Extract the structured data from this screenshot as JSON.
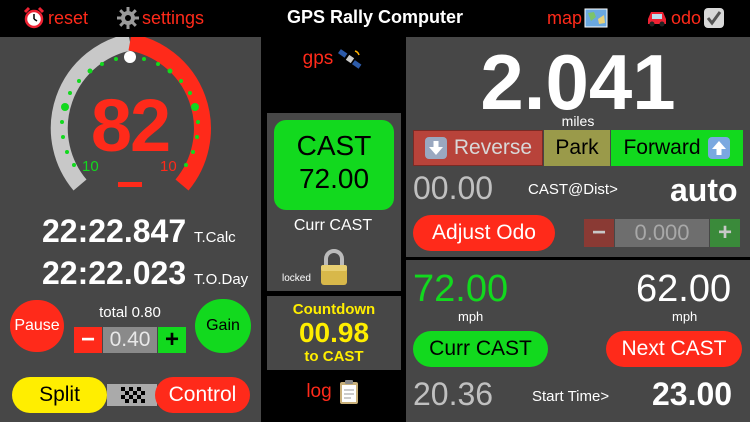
{
  "topbar": {
    "reset_label": "reset",
    "settings_label": "settings",
    "title": "GPS Rally Computer",
    "map_label": "map",
    "odo_label": "odo"
  },
  "gauge": {
    "value": "82",
    "min_label": "10",
    "max_label": "10",
    "accent": "#ff2a1a",
    "tick_color": "#12d91e"
  },
  "left": {
    "tcalc_time": "22:22.847",
    "tcalc_label": "T.Calc",
    "today_time": "22:22.023",
    "today_label": "T.O.Day",
    "pause_label": "Pause",
    "total_label": "total 0.80",
    "step_value": "0.40",
    "gain_label": "Gain",
    "split_label": "Split",
    "control_label": "Control"
  },
  "middle": {
    "gps_label": "gps",
    "cast_title": "CAST",
    "cast_value": "72.00",
    "curr_cast_label": "Curr CAST",
    "locked_label": "locked",
    "countdown_label": "Countdown",
    "countdown_value": "00.98",
    "to_cast_label": "to CAST",
    "log_label": "log"
  },
  "right_top": {
    "distance": "2.041",
    "distance_unit": "miles",
    "reverse_label": "Reverse",
    "park_label": "Park",
    "forward_label": "Forward",
    "cast_at_dist_value": "00.00",
    "cast_at_dist_label": "CAST@Dist>",
    "mode": "auto",
    "adjust_odo_label": "Adjust Odo",
    "adjust_value": "0.000"
  },
  "right_bottom": {
    "curr_speed": "72.00",
    "curr_speed_unit": "mph",
    "next_speed": "62.00",
    "next_speed_unit": "mph",
    "curr_cast_label": "Curr CAST",
    "next_cast_label": "Next CAST",
    "start_time_value": "20.36",
    "start_time_label": "Start Time>",
    "start_time_right": "23.00"
  }
}
